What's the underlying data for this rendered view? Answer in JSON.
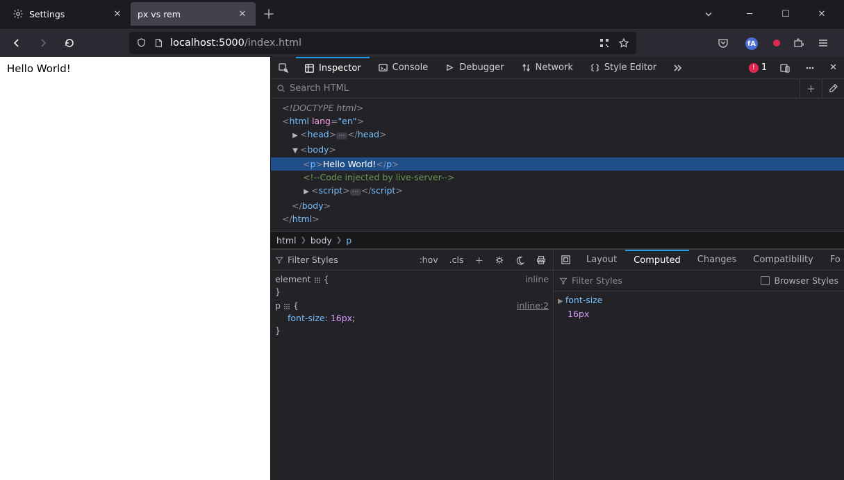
{
  "tabs": [
    {
      "label": "Settings",
      "active": false
    },
    {
      "label": "px vs rem",
      "active": true
    }
  ],
  "url": {
    "host": "localhost:",
    "port": "5000",
    "path": "/index.html"
  },
  "page": {
    "text": "Hello World!"
  },
  "devtools": {
    "tabs": {
      "inspector": "Inspector",
      "console": "Console",
      "debugger": "Debugger",
      "network": "Network",
      "style": "Style Editor"
    },
    "error_count": "1",
    "search_placeholder": "Search HTML",
    "dom": {
      "doctype": "<!DOCTYPE html>",
      "html_open_pre": "<",
      "html_tag": "html",
      "html_lang_attr": "lang",
      "html_lang_val": "\"en\"",
      "html_open_post": ">",
      "head_tag": "head",
      "body_tag": "body",
      "p_open": "<",
      "p_tag": "p",
      "p_text": "Hello World!",
      "p_close": "p",
      "comment": "<!--Code injected by live-server-->",
      "script_tag": "script",
      "html_close": "</",
      "html_close_tag": "html",
      "html_close_end": ">"
    },
    "breadcrumbs": {
      "a": "html",
      "b": "body",
      "c": "p"
    },
    "rules": {
      "filter_placeholder": "Filter Styles",
      "hov": ":hov",
      "cls": ".cls",
      "el_sel": "element",
      "el_src": "inline",
      "p_sel": "p",
      "p_src": "inline:2",
      "prop": "font-size",
      "val": "16px"
    },
    "sidebar": {
      "layout": "Layout",
      "computed": "Computed",
      "changes": "Changes",
      "compat": "Compatibility",
      "fonts": "Fo",
      "filter_placeholder": "Filter Styles",
      "browser_styles": "Browser Styles",
      "computed_prop": "font-size",
      "computed_val": "16px"
    }
  }
}
